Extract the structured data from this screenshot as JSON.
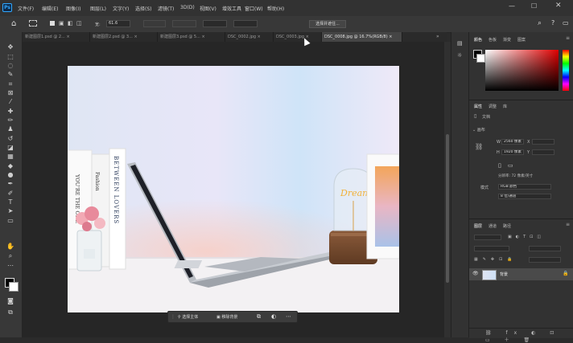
{
  "app": {
    "logo": "Ps"
  },
  "menu": [
    "文件(F)",
    "编辑(E)",
    "图像(I)",
    "图层(L)",
    "文字(Y)",
    "选择(S)",
    "滤镜(T)",
    "3D(D)",
    "视图(V)",
    "增效工具",
    "窗口(W)",
    "帮助(H)"
  ],
  "options": {
    "width_label": "宽:",
    "width_value": "61.6",
    "action_button": "选择并遮住..."
  },
  "tabs": [
    {
      "label": "新建图层1.psd @ 2...",
      "active": false
    },
    {
      "label": "新建图层2.psd @ 3...",
      "active": false
    },
    {
      "label": "新建图层3.psd @ 5...",
      "active": false
    },
    {
      "label": "DSC_0002.jpg",
      "active": false
    },
    {
      "label": "DSC_0003.jpg",
      "active": false
    },
    {
      "label": "DSC_0008.jpg @ 16.7%(RGB/8)",
      "active": true
    }
  ],
  "panels": {
    "color_tabs": [
      "颜色",
      "色板",
      "渐变",
      "图案"
    ],
    "properties_tabs": [
      "属性",
      "调整",
      "库"
    ],
    "doc_label": "文档",
    "canvas_section": "画布",
    "w_label": "W",
    "w_value": "2560 像素",
    "h_label": "H",
    "h_value": "1920 像素",
    "x_label": "X",
    "y_label": "Y",
    "resolution": "分辨率: 72 像素/英寸",
    "mode_label": "模式",
    "mode_value": "RGB 颜色",
    "bit_value": "8 位/通道",
    "layers_tabs": [
      "图层",
      "通道",
      "路径"
    ],
    "layer_name": "背景"
  },
  "ctxbar": {
    "select_subject": "选择主体",
    "remove_bg": "移除背景"
  },
  "image": {
    "book1": "BETWEEN LOVERS",
    "book2": "Fashion",
    "book3": "YOU'RE THE ONE",
    "lamp": "Dream"
  }
}
